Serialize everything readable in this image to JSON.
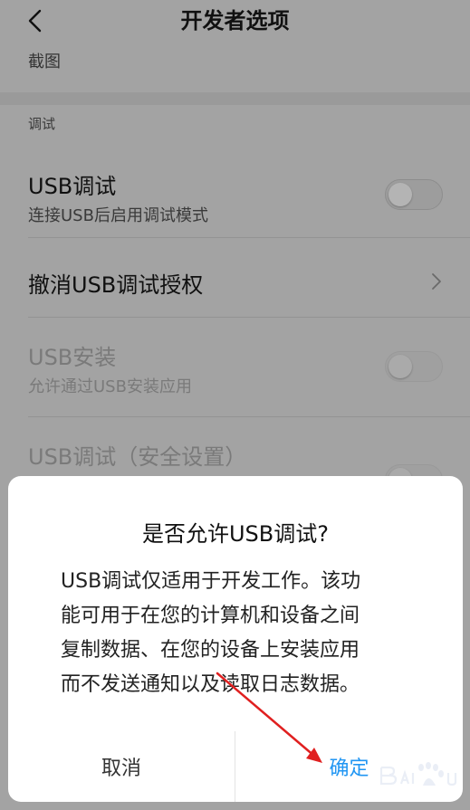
{
  "header": {
    "title": "开发者选项"
  },
  "rows_top": {
    "screenshot_label": "截图"
  },
  "section": {
    "title": "调试"
  },
  "settings": [
    {
      "primary": "USB调试",
      "secondary": "连接USB后启用调试模式",
      "toggle": "off",
      "enabled": true
    },
    {
      "primary": "撤消USB调试授权",
      "chevron": true,
      "enabled": true
    },
    {
      "primary": "USB安装",
      "secondary": "允许通过USB安装应用",
      "toggle": "off",
      "enabled": false
    },
    {
      "primary": "USB调试（安全设置）",
      "toggle": "off",
      "enabled": false
    }
  ],
  "dialog": {
    "title": "是否允许USB调试?",
    "body_lines": [
      "USB调试仅适用于开发工作。该功",
      "能可用于在您的计算机和设备之间",
      "复制数据、在您的设备上安装应用",
      "而不发送通知以及读取日志数据。"
    ],
    "cancel_label": "取消",
    "confirm_label": "确定"
  },
  "colors": {
    "dimmed_background": "#a3a3a3",
    "dialog_background": "#ffffff",
    "confirm_accent": "#2196f3",
    "annotation_arrow": "#e02020"
  },
  "icons": {
    "back": "chevron-left-icon",
    "row_chevron": "chevron-right-icon",
    "arrow": "red-annotation-arrow",
    "watermark": "baidu-paw-logo"
  }
}
